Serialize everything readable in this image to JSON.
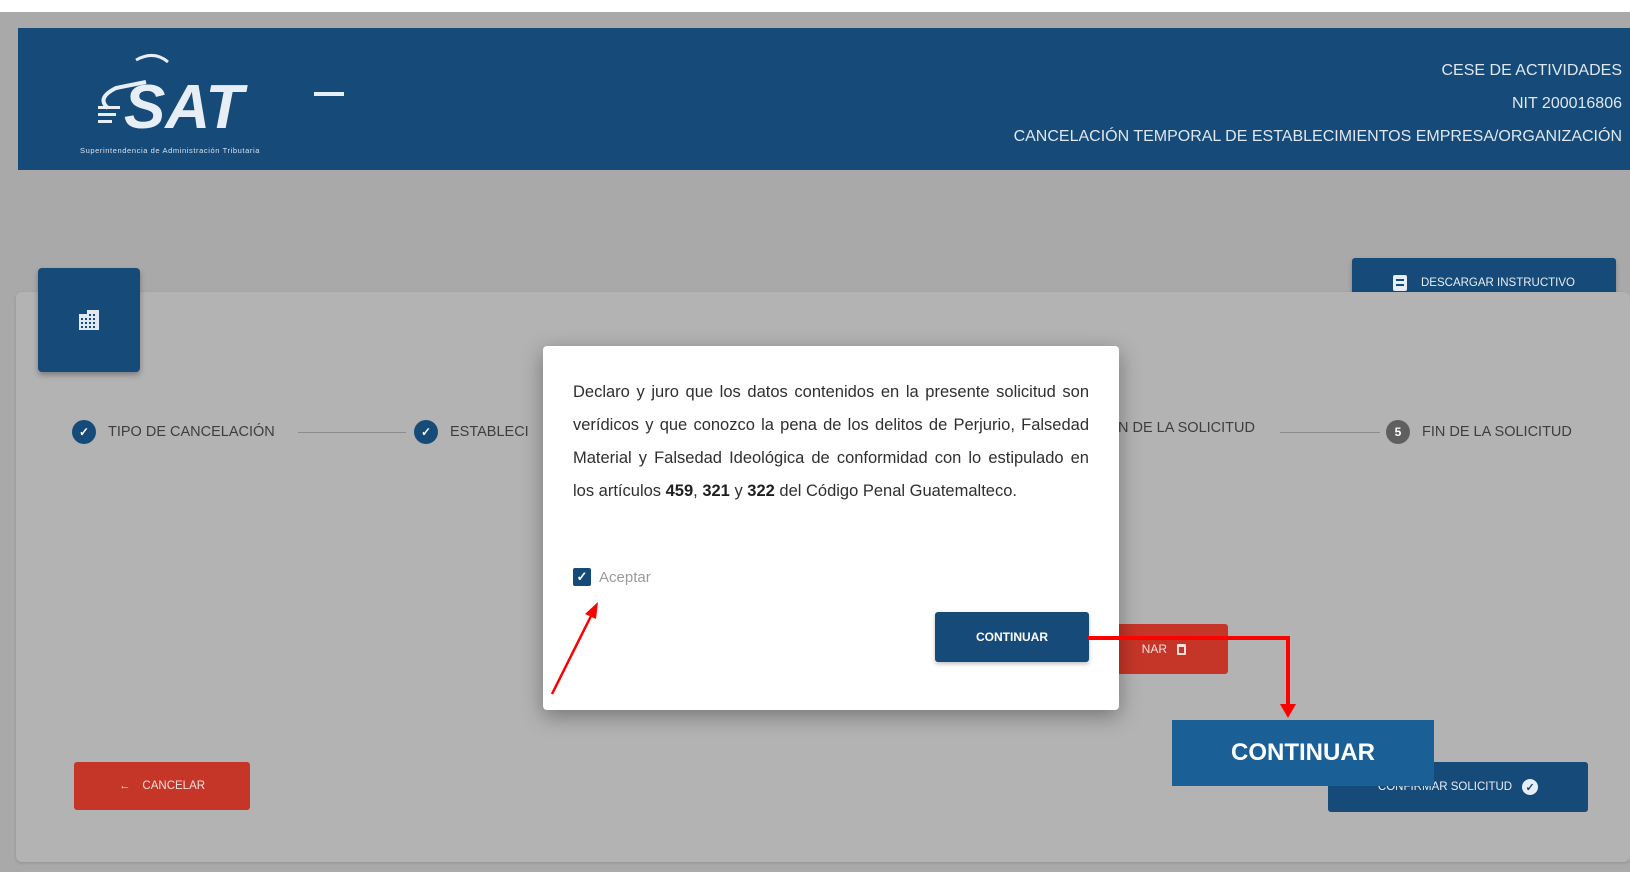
{
  "header": {
    "logo_text": "SAT",
    "logo_caption": "Superintendencia de Administración Tributaria",
    "line1": "CESE DE ACTIVIDADES",
    "line2": "NIT 200016806",
    "line3": "CANCELACIÓN TEMPORAL DE ESTABLECIMIENTOS EMPRESA/ORGANIZACIÓN"
  },
  "toolbar": {
    "download_label": "DESCARGAR INSTRUCTIVO"
  },
  "steps": [
    {
      "label": "TIPO DE CANCELACIÓN",
      "state": "done"
    },
    {
      "label": "ESTABLECI",
      "state": "done"
    },
    {
      "label": "N DE LA SOLICITUD",
      "state": "partial"
    },
    {
      "label": "FIN DE LA SOLICITUD",
      "number": "5",
      "state": "pending"
    }
  ],
  "buttons": {
    "cancel_label": "CANCELAR",
    "eliminar_label": "NAR",
    "confirm_label": "CONFIRMAR SOLICITUD"
  },
  "modal": {
    "text_part1": "Declaro y juro que los datos contenidos en la presente solicitud son verídicos y que conozco la pena de los delitos de Perjurio, Falsedad Material y Falsedad Ideológica de conformidad con lo estipulado en los artículos ",
    "art1": "459",
    "sep1": ", ",
    "art2": "321",
    "sep2": " y ",
    "art3": "322",
    "text_part2": " del Código Penal Guatemalteco.",
    "accept_label": "Aceptar",
    "accept_checked": true,
    "continue_label": "CONTINUAR"
  },
  "annotation": {
    "callout_label": "CONTINUAR",
    "arrow_color": "#ff0000"
  },
  "colors": {
    "primary": "#164a78",
    "danger": "#c63628",
    "overlay": "#a9a9a9"
  }
}
